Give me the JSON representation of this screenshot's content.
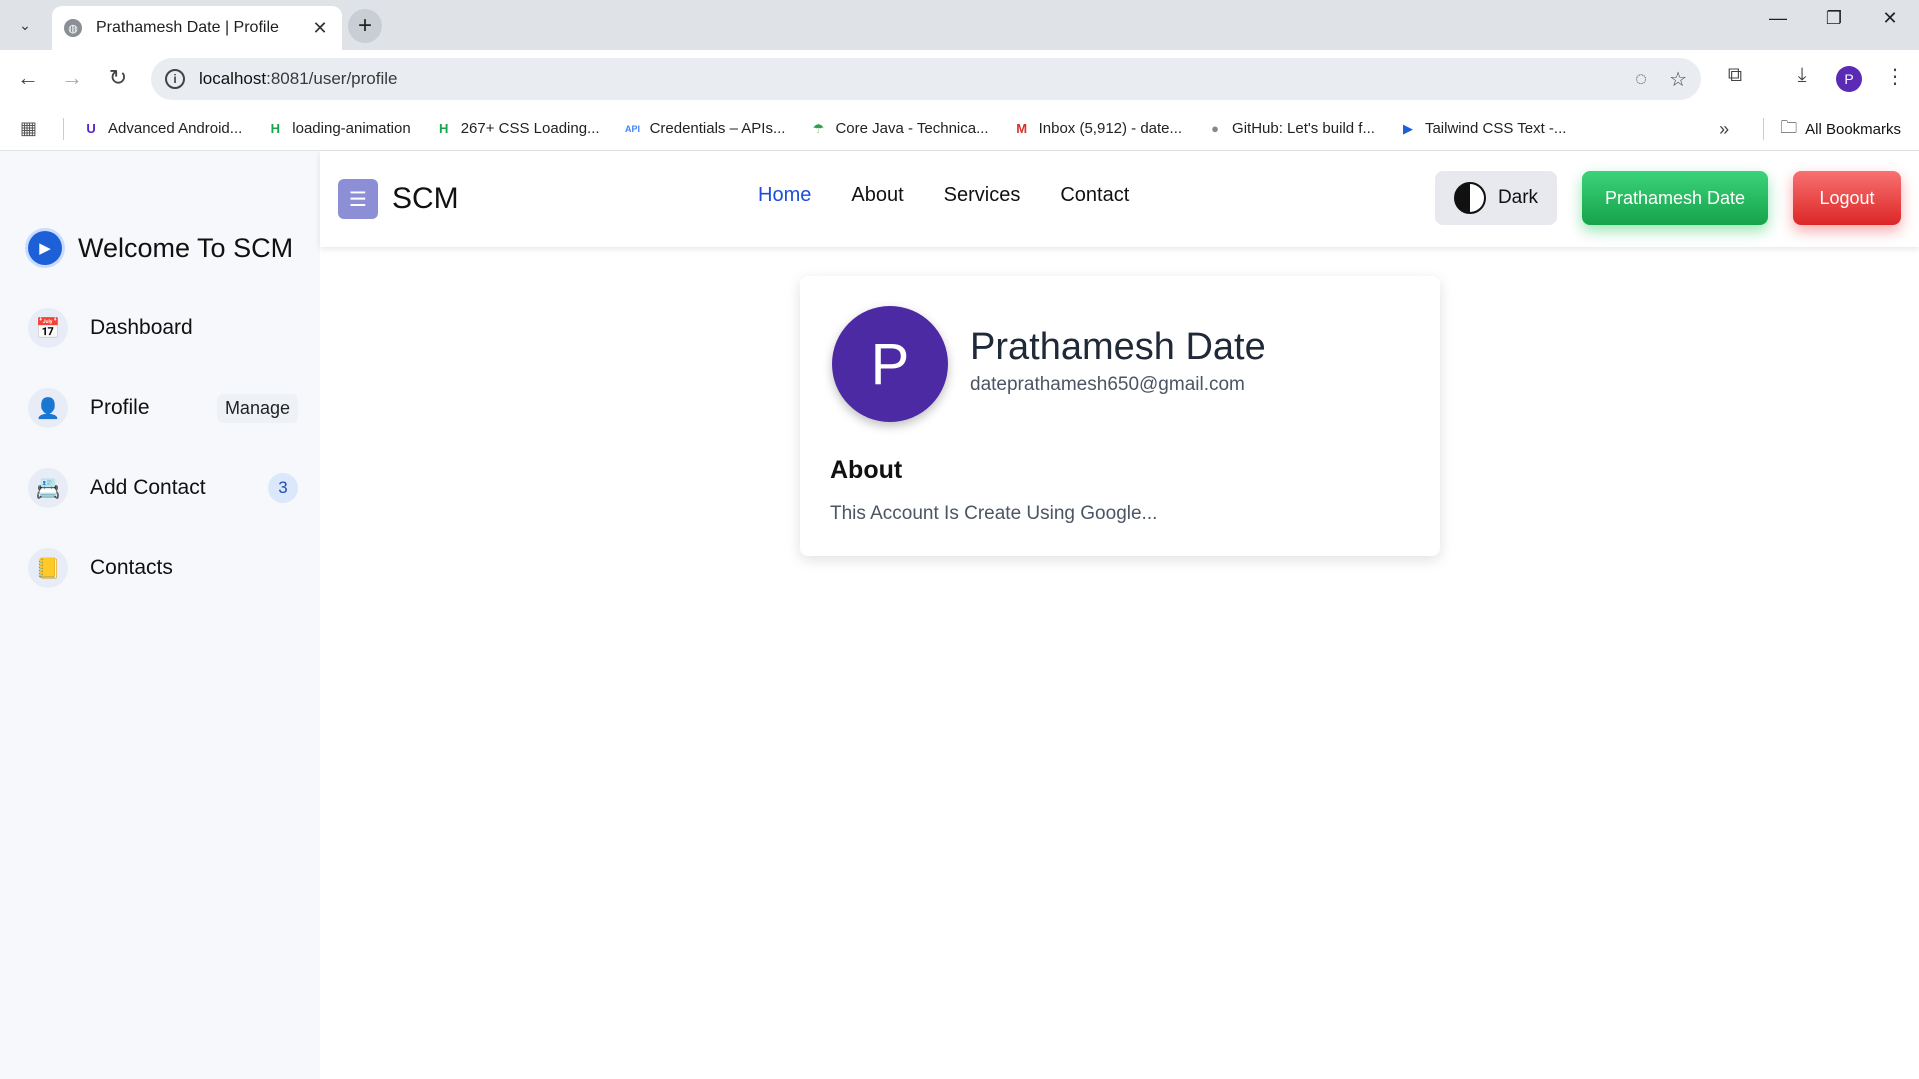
{
  "browser": {
    "tab_title": "Prathamesh Date | Profile",
    "url_host": "localhost",
    "url_rest": ":8081/user/profile",
    "profile_initial": "P",
    "bookmarks": [
      {
        "label": "Advanced Android...",
        "icon": "udemy-icon",
        "glyph": "U",
        "color": "#5624d0"
      },
      {
        "label": "loading-animation",
        "icon": "h-icon",
        "glyph": "H",
        "color": "#1aa34a"
      },
      {
        "label": "267+ CSS Loading...",
        "icon": "h-icon",
        "glyph": "H",
        "color": "#1aa34a"
      },
      {
        "label": "Credentials – APIs...",
        "icon": "api-icon",
        "glyph": "API",
        "color": "#4285f4"
      },
      {
        "label": "Core Java - Technica...",
        "icon": "leaf-icon",
        "glyph": "☂",
        "color": "#2e9e4a"
      },
      {
        "label": "Inbox (5,912) - date...",
        "icon": "gmail-icon",
        "glyph": "M",
        "color": "#d93025"
      },
      {
        "label": "GitHub: Let's build f...",
        "icon": "github-icon",
        "glyph": "●",
        "color": "#888"
      },
      {
        "label": "Tailwind CSS Text -...",
        "icon": "play-icon",
        "glyph": "▶",
        "color": "#1d5fd6"
      }
    ],
    "all_bookmarks": "All Bookmarks"
  },
  "sidebar": {
    "welcome": "Welcome To SCM",
    "items": [
      {
        "label": "Dashboard",
        "icon": "dashboard-icon",
        "glyph": "📅"
      },
      {
        "label": "Profile",
        "icon": "profile-icon",
        "glyph": "👤",
        "badge": "Manage"
      },
      {
        "label": "Add Contact",
        "icon": "add-contact-icon",
        "glyph": "📇",
        "count": "3"
      },
      {
        "label": "Contacts",
        "icon": "contacts-icon",
        "glyph": "📒"
      }
    ]
  },
  "navbar": {
    "brand": "SCM",
    "links": [
      "Home",
      "About",
      "Services",
      "Contact"
    ],
    "theme_label": "Dark",
    "user_button": "Prathamesh Date",
    "logout_label": "Logout"
  },
  "profile": {
    "initial": "P",
    "name": "Prathamesh Date",
    "email": "dateprathamesh650@gmail.com",
    "about_heading": "About",
    "about_text": "This Account Is Create Using Google..."
  },
  "colors": {
    "accent": "#1d4ed8",
    "avatar": "#4c2aa3",
    "user_button": "#22c55e",
    "logout_button": "#ef4444"
  }
}
